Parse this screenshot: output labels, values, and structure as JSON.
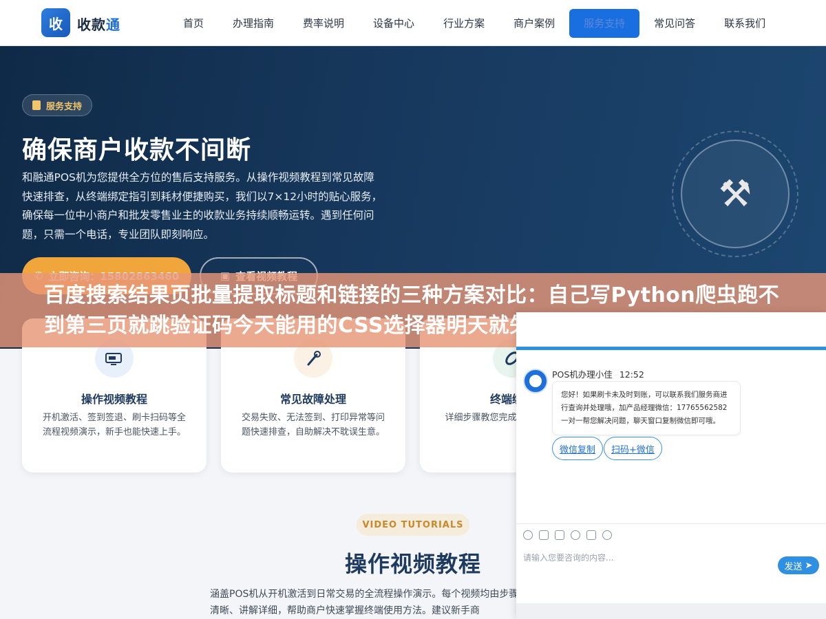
{
  "header": {
    "logo_mark": "收",
    "logo_text_a": "收款",
    "logo_text_b": "通",
    "nav": [
      "首页",
      "办理指南",
      "费率说明",
      "设备中心",
      "行业方案",
      "商户案例",
      "服务支持",
      "常见问答",
      "联系我们"
    ],
    "active_index": 6
  },
  "hero": {
    "badge": "服务支持",
    "title": "确保商户收款不间断",
    "description": "和融通POS机为您提供全方位的售后支持服务。从操作视频教程到常见故障快速排查，从终端绑定指引到耗材便捷购买，我们以7×12小时的贴心服务，确保每一位中小商户和批发零售业主的收款业务持续顺畅运转。遇到任何问题，只需一个电话，专业团队即刻响应。",
    "call_button": "立即咨询：15802863460",
    "video_button": "查看视频教程"
  },
  "banner": {
    "text": "百度搜索结果页批量提取标题和链接的三种方案对比：自己写Python爬虫跑不到第三页就跳验证码今天能用的CSS选择器明天就失效，商业API"
  },
  "cards": [
    {
      "title": "操作视频教程",
      "desc": "开机激活、签到签退、刷卡扫码等全流程视频演示，新手也能快速上手。",
      "icon": "tv-icon",
      "bg": "#e8f1fb"
    },
    {
      "title": "常见故障处理",
      "desc": "交易失败、无法签到、打印异常等问题快速排查，自助解决不耽误生意。",
      "icon": "wrench-icon",
      "bg": "#fbf1e4"
    },
    {
      "title": "终端绑定",
      "desc": "详细步骤教您完成设置，轻松连接",
      "icon": "link-icon",
      "bg": "#e7f5ee"
    }
  ],
  "section": {
    "pill": "VIDEO TUTORIALS",
    "title": "操作视频教程",
    "desc": "涵盖POS机从开机激活到日常交易的全流程操作演示。每个视频均由步骤清晰、讲解详细，帮助商户快速掌握终端使用方法。建议新手商"
  },
  "chat": {
    "agent_name": "POS机办理小佳",
    "time": "12:52",
    "message": "您好！如果刷卡未及时到账，可以联系我们服务商进行查询并处理哦，加产品经理微信：17765562582 一对一帮您解决问题，聊天窗口复制微信即可哦。",
    "btn_copy": "微信复制",
    "btn_scan": "扫码+微信",
    "input_placeholder": "请输入您要咨询的内容...",
    "send": "发送",
    "minimize": "–",
    "maximize": "□"
  },
  "colors": {
    "brand": "#1a6fe0",
    "accent_orange": "#f0a63a",
    "hero_dark": "#0f2a47"
  }
}
